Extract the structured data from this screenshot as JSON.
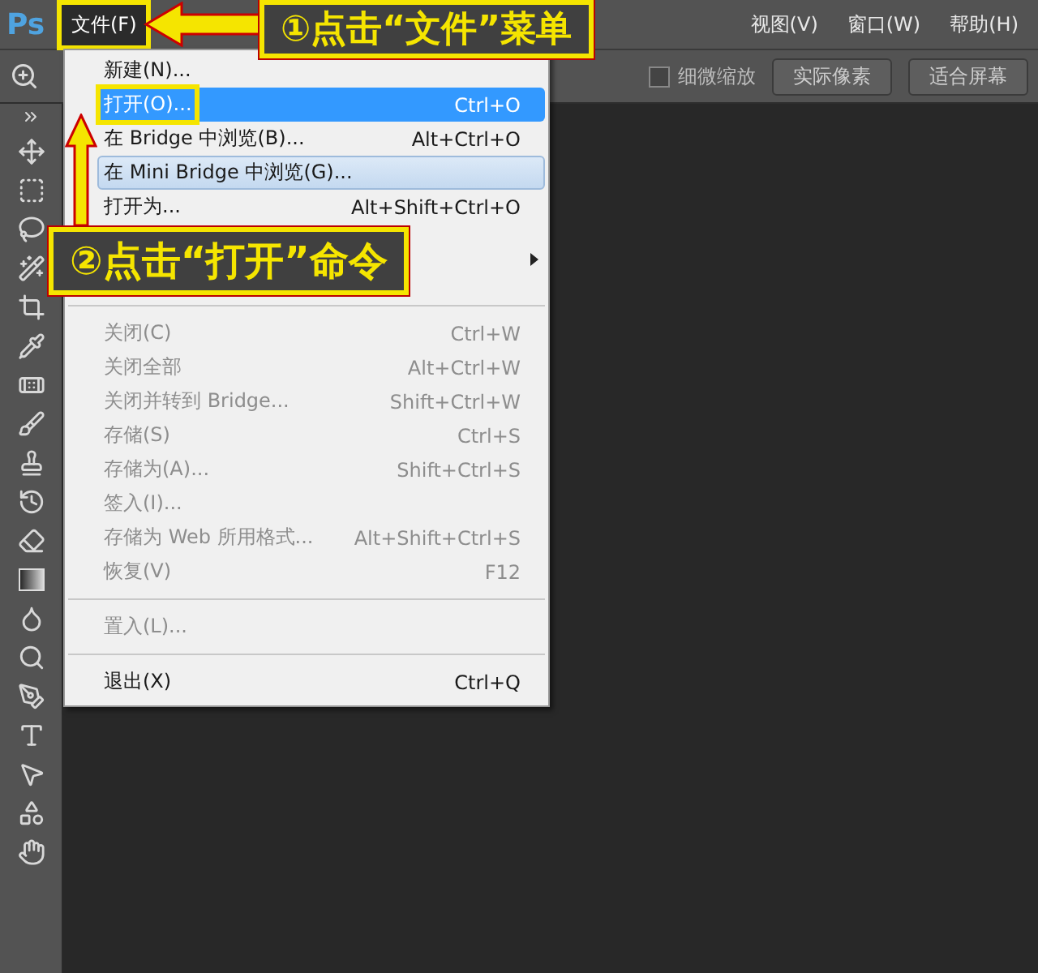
{
  "app": {
    "logo": "Ps"
  },
  "menu_bar": [
    {
      "label": "文件(F)",
      "selected": true,
      "marked": true
    },
    {
      "label": "视图(V)",
      "selected": false,
      "marked": false
    },
    {
      "label": "窗口(W)",
      "selected": false,
      "marked": false
    },
    {
      "label": "帮助(H)",
      "selected": false,
      "marked": false
    }
  ],
  "options_bar": {
    "checkbox": {
      "label": "细微缩放",
      "checked": false
    },
    "buttons": [
      "实际像素",
      "适合屏幕"
    ]
  },
  "file_menu": [
    {
      "kind": "item",
      "label": "新建(N)...",
      "disabled": false,
      "selected": false,
      "hovered": false,
      "marked": false
    },
    {
      "kind": "item",
      "label": "打开(O)...",
      "shortcut": "Ctrl+O",
      "disabled": false,
      "selected": true,
      "hovered": false,
      "marked": true
    },
    {
      "kind": "item",
      "label": "在 Bridge 中浏览(B)...",
      "shortcut": "Alt+Ctrl+O",
      "disabled": false,
      "selected": false,
      "hovered": false,
      "marked": false
    },
    {
      "kind": "item",
      "label": "在 Mini Bridge 中浏览(G)...",
      "disabled": false,
      "selected": false,
      "hovered": true,
      "marked": false
    },
    {
      "kind": "item",
      "label": "打开为...",
      "shortcut": "Alt+Shift+Ctrl+O",
      "disabled": false,
      "selected": false,
      "hovered": false,
      "marked": false
    },
    {
      "kind": "obscured",
      "submenu": true
    },
    {
      "kind": "separator"
    },
    {
      "kind": "item",
      "label": "关闭(C)",
      "shortcut": "Ctrl+W",
      "disabled": true,
      "selected": false,
      "hovered": false,
      "marked": false
    },
    {
      "kind": "item",
      "label": "关闭全部",
      "shortcut": "Alt+Ctrl+W",
      "disabled": true,
      "selected": false,
      "hovered": false,
      "marked": false
    },
    {
      "kind": "item",
      "label": "关闭并转到 Bridge...",
      "shortcut": "Shift+Ctrl+W",
      "disabled": true,
      "selected": false,
      "hovered": false,
      "marked": false
    },
    {
      "kind": "item",
      "label": "存储(S)",
      "shortcut": "Ctrl+S",
      "disabled": true,
      "selected": false,
      "hovered": false,
      "marked": false
    },
    {
      "kind": "item",
      "label": "存储为(A)...",
      "shortcut": "Shift+Ctrl+S",
      "disabled": true,
      "selected": false,
      "hovered": false,
      "marked": false
    },
    {
      "kind": "item",
      "label": "签入(I)...",
      "disabled": true,
      "selected": false,
      "hovered": false,
      "marked": false
    },
    {
      "kind": "item",
      "label": "存储为 Web 所用格式...",
      "shortcut": "Alt+Shift+Ctrl+S",
      "disabled": true,
      "selected": false,
      "hovered": false,
      "marked": false
    },
    {
      "kind": "item",
      "label": "恢复(V)",
      "shortcut": "F12",
      "disabled": true,
      "selected": false,
      "hovered": false,
      "marked": false
    },
    {
      "kind": "separator"
    },
    {
      "kind": "item",
      "label": "置入(L)...",
      "disabled": true,
      "selected": false,
      "hovered": false,
      "marked": false
    },
    {
      "kind": "separator"
    },
    {
      "kind": "item",
      "label": "退出(X)",
      "shortcut": "Ctrl+Q",
      "disabled": false,
      "selected": false,
      "hovered": false,
      "marked": false
    }
  ],
  "callouts": [
    {
      "text": "①点击“文件”菜单",
      "kind": "leftward"
    },
    {
      "text": "②点击“打开”命令",
      "kind": "upward"
    }
  ]
}
